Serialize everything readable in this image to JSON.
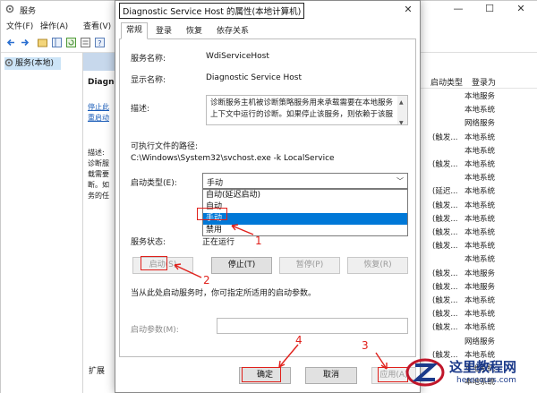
{
  "services_window": {
    "title": "服务",
    "menus": [
      "文件(F)",
      "操作(A)",
      "查看(V)"
    ],
    "tree_item": "服务(本地)",
    "detail_fragments": [
      "Diagno",
      "停止此",
      "重启动",
      "描述:",
      "诊断服",
      "载需要",
      "断。如",
      "务的任"
    ],
    "bottom_tab": "扩展",
    "list_headers": [
      "启动类型",
      "登录为"
    ],
    "list_rows": [
      [
        "",
        "本地服务"
      ],
      [
        "",
        "本地系统"
      ],
      [
        "",
        "网络服务"
      ],
      [
        "(触发...",
        "本地系统"
      ],
      [
        "",
        "本地系统"
      ],
      [
        "(触发...",
        "本地系统"
      ],
      [
        "",
        "本地系统"
      ],
      [
        "(延迟...",
        "本地系统"
      ],
      [
        "(触发...",
        "本地系统"
      ],
      [
        "(触发...",
        "本地系统"
      ],
      [
        "(触发...",
        "本地系统"
      ],
      [
        "(触发...",
        "本地系统"
      ],
      [
        "",
        "本地系统"
      ],
      [
        "(触发...",
        "本地服务"
      ],
      [
        "(触发...",
        "本地服务"
      ],
      [
        "(触发...",
        "本地系统"
      ],
      [
        "(触发...",
        "本地系统"
      ],
      [
        "(触发...",
        "本地系统"
      ],
      [
        "",
        "网络服务"
      ],
      [
        "(触发...",
        "本地系统"
      ],
      [
        "",
        "本地系统"
      ],
      [
        "",
        "本地系统"
      ]
    ]
  },
  "dialog": {
    "title": "Diagnostic Service Host 的属性(本地计算机)",
    "close": "✕",
    "tabs": [
      "常规",
      "登录",
      "恢复",
      "依存关系"
    ],
    "service_name_label": "服务名称:",
    "service_name": "WdiServiceHost",
    "display_name_label": "显示名称:",
    "display_name": "Diagnostic Service Host",
    "description_label": "描述:",
    "description": "诊断服务主机被诊断策略服务用来承载需要在本地服务上下文中运行的诊断。如果停止该服务，则依赖于该服",
    "exe_path_label": "可执行文件的路径:",
    "exe_path": "C:\\Windows\\System32\\svchost.exe -k LocalService",
    "startup_type_label": "启动类型(E):",
    "startup_type_value": "手动",
    "startup_options": [
      "自动(延迟启动)",
      "自动",
      "手动",
      "禁用"
    ],
    "selected_option_index": 2,
    "status_label": "服务状态:",
    "status_value": "正在运行",
    "buttons": {
      "start": "启动(S)",
      "stop": "停止(T)",
      "pause": "暂停(P)",
      "resume": "恢复(R)"
    },
    "hint": "当从此处启动服务时，你可指定所适用的启动参数。",
    "start_params_label": "启动参数(M):",
    "ok": "确定",
    "cancel": "取消",
    "apply": "应用(A)"
  },
  "annotations": [
    "1",
    "2",
    "3",
    "4"
  ],
  "watermark": {
    "text": "这里教程网",
    "url": "herecours.com"
  },
  "colors": {
    "accent": "#0078d7",
    "annotation": "#e0201b",
    "tree_selection": "#cce4f7"
  }
}
